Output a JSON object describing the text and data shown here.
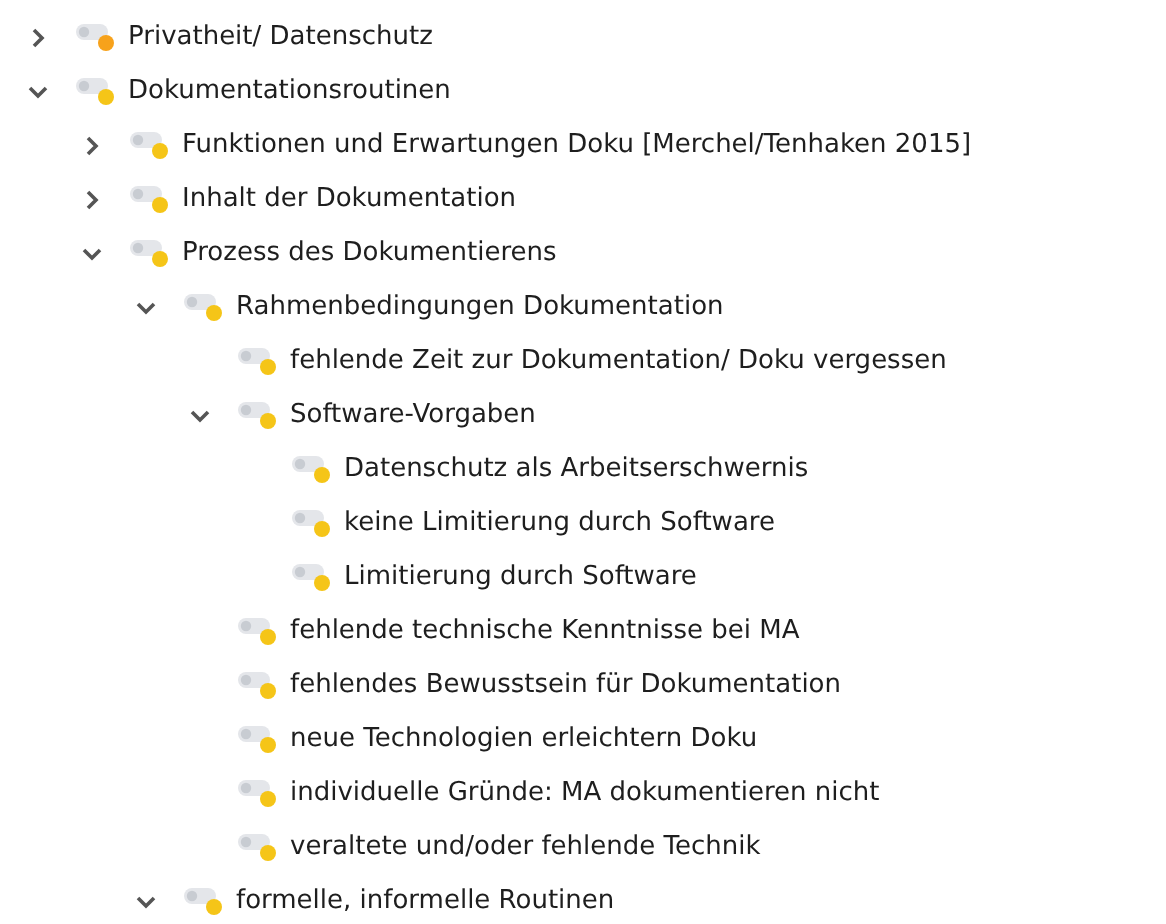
{
  "tree": [
    {
      "label": "Privatheit/ Datenschutz",
      "color": "#f7a21b",
      "expanded": false
    },
    {
      "label": "Dokumentationsroutinen",
      "color": "#f5c518",
      "expanded": true,
      "children": [
        {
          "label": "Funktionen und Erwartungen Doku [Merchel/Tenhaken 2015]",
          "color": "#f5c518",
          "expanded": false
        },
        {
          "label": "Inhalt der Dokumentation",
          "color": "#f5c518",
          "expanded": false
        },
        {
          "label": "Prozess des Dokumentierens",
          "color": "#f5c518",
          "expanded": true,
          "children": [
            {
              "label": "Rahmenbedingungen Dokumentation",
              "color": "#f5c518",
              "expanded": true,
              "children": [
                {
                  "label": "fehlende Zeit zur Dokumentation/ Doku vergessen",
                  "color": "#f5c518"
                },
                {
                  "label": "Software-Vorgaben",
                  "color": "#f5c518",
                  "expanded": true,
                  "children": [
                    {
                      "label": "Datenschutz als Arbeitserschwernis",
                      "color": "#f5c518"
                    },
                    {
                      "label": "keine Limitierung durch Software",
                      "color": "#f5c518"
                    },
                    {
                      "label": "Limitierung durch Software",
                      "color": "#f5c518"
                    }
                  ]
                },
                {
                  "label": "fehlende technische Kenntnisse bei MA",
                  "color": "#f5c518"
                },
                {
                  "label": "fehlendes Bewusstsein für Dokumentation",
                  "color": "#f5c518"
                },
                {
                  "label": "neue Technologien erleichtern Doku",
                  "color": "#f5c518"
                },
                {
                  "label": "individuelle Gründe: MA dokumentieren nicht",
                  "color": "#f5c518"
                },
                {
                  "label": "veraltete und/oder fehlende Technik",
                  "color": "#f5c518"
                }
              ]
            },
            {
              "label": "formelle, informelle Routinen",
              "color": "#f5c518",
              "expanded": true
            }
          ]
        }
      ]
    }
  ]
}
